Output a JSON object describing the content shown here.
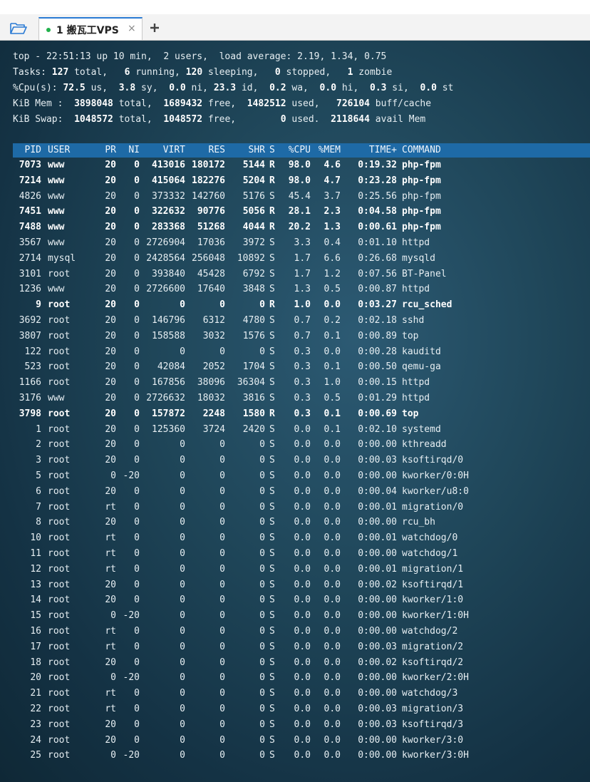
{
  "tabbar": {
    "tab_label": "1 搬瓦工VPS",
    "close_glyph": "×",
    "plus_glyph": "+",
    "status_color": "#22b14c"
  },
  "summary": {
    "line1": [
      [
        "top - 22:51:13 up 10 min,  2 users,  load average: 2.19, 1.34, 0.75",
        false
      ]
    ],
    "line2": [
      [
        "Tasks: ",
        false
      ],
      [
        "127",
        true
      ],
      [
        " total,   ",
        false
      ],
      [
        "6",
        true
      ],
      [
        " running, ",
        false
      ],
      [
        "120",
        true
      ],
      [
        " sleeping,   ",
        false
      ],
      [
        "0",
        true
      ],
      [
        " stopped,   ",
        false
      ],
      [
        "1",
        true
      ],
      [
        " zombie",
        false
      ]
    ],
    "line3": [
      [
        "%Cpu(s): ",
        false
      ],
      [
        "72.5",
        true
      ],
      [
        " us,  ",
        false
      ],
      [
        "3.8",
        true
      ],
      [
        " sy,  ",
        false
      ],
      [
        "0.0",
        true
      ],
      [
        " ni, ",
        false
      ],
      [
        "23.3",
        true
      ],
      [
        " id,  ",
        false
      ],
      [
        "0.2",
        true
      ],
      [
        " wa,  ",
        false
      ],
      [
        "0.0",
        true
      ],
      [
        " hi,  ",
        false
      ],
      [
        "0.3",
        true
      ],
      [
        " si,  ",
        false
      ],
      [
        "0.0",
        true
      ],
      [
        " st",
        false
      ]
    ],
    "line4": [
      [
        "KiB Mem :  ",
        false
      ],
      [
        "3898048",
        true
      ],
      [
        " total,  ",
        false
      ],
      [
        "1689432",
        true
      ],
      [
        " free,  ",
        false
      ],
      [
        "1482512",
        true
      ],
      [
        " used,   ",
        false
      ],
      [
        "726104",
        true
      ],
      [
        " buff/cache",
        false
      ]
    ],
    "line5": [
      [
        "KiB Swap:  ",
        false
      ],
      [
        "1048572",
        true
      ],
      [
        " total,  ",
        false
      ],
      [
        "1048572",
        true
      ],
      [
        " free,        ",
        false
      ],
      [
        "0",
        true
      ],
      [
        " used.  ",
        false
      ],
      [
        "2118644",
        true
      ],
      [
        " avail Mem",
        false
      ]
    ]
  },
  "table": {
    "headers": [
      "PID",
      "USER",
      "PR",
      "NI",
      "VIRT",
      "RES",
      "SHR",
      "S",
      "%CPU",
      "%MEM",
      "TIME+",
      "COMMAND"
    ],
    "rows": [
      {
        "bold": true,
        "cells": [
          "7073",
          "www",
          "20",
          "0",
          "413016",
          "180172",
          "5144",
          "R",
          "98.0",
          "4.6",
          "0:19.32",
          "php-fpm"
        ]
      },
      {
        "bold": true,
        "cells": [
          "7214",
          "www",
          "20",
          "0",
          "415064",
          "182276",
          "5204",
          "R",
          "98.0",
          "4.7",
          "0:23.28",
          "php-fpm"
        ]
      },
      {
        "bold": false,
        "cells": [
          "4826",
          "www",
          "20",
          "0",
          "373332",
          "142760",
          "5176",
          "S",
          "45.4",
          "3.7",
          "0:25.56",
          "php-fpm"
        ]
      },
      {
        "bold": true,
        "cells": [
          "7451",
          "www",
          "20",
          "0",
          "322632",
          "90776",
          "5056",
          "R",
          "28.1",
          "2.3",
          "0:04.58",
          "php-fpm"
        ]
      },
      {
        "bold": true,
        "cells": [
          "7488",
          "www",
          "20",
          "0",
          "283368",
          "51268",
          "4044",
          "R",
          "20.2",
          "1.3",
          "0:00.61",
          "php-fpm"
        ]
      },
      {
        "bold": false,
        "cells": [
          "3567",
          "www",
          "20",
          "0",
          "2726904",
          "17036",
          "3972",
          "S",
          "3.3",
          "0.4",
          "0:01.10",
          "httpd"
        ]
      },
      {
        "bold": false,
        "cells": [
          "2714",
          "mysql",
          "20",
          "0",
          "2428564",
          "256048",
          "10892",
          "S",
          "1.7",
          "6.6",
          "0:26.68",
          "mysqld"
        ]
      },
      {
        "bold": false,
        "cells": [
          "3101",
          "root",
          "20",
          "0",
          "393840",
          "45428",
          "6792",
          "S",
          "1.7",
          "1.2",
          "0:07.56",
          "BT-Panel"
        ]
      },
      {
        "bold": false,
        "cells": [
          "1236",
          "www",
          "20",
          "0",
          "2726600",
          "17640",
          "3848",
          "S",
          "1.3",
          "0.5",
          "0:00.87",
          "httpd"
        ]
      },
      {
        "bold": true,
        "cells": [
          "9",
          "root",
          "20",
          "0",
          "0",
          "0",
          "0",
          "R",
          "1.0",
          "0.0",
          "0:03.27",
          "rcu_sched"
        ]
      },
      {
        "bold": false,
        "cells": [
          "3692",
          "root",
          "20",
          "0",
          "146796",
          "6312",
          "4780",
          "S",
          "0.7",
          "0.2",
          "0:02.18",
          "sshd"
        ]
      },
      {
        "bold": false,
        "cells": [
          "3807",
          "root",
          "20",
          "0",
          "158588",
          "3032",
          "1576",
          "S",
          "0.7",
          "0.1",
          "0:00.89",
          "top"
        ]
      },
      {
        "bold": false,
        "cells": [
          "122",
          "root",
          "20",
          "0",
          "0",
          "0",
          "0",
          "S",
          "0.3",
          "0.0",
          "0:00.28",
          "kauditd"
        ]
      },
      {
        "bold": false,
        "cells": [
          "523",
          "root",
          "20",
          "0",
          "42084",
          "2052",
          "1704",
          "S",
          "0.3",
          "0.1",
          "0:00.50",
          "qemu-ga"
        ]
      },
      {
        "bold": false,
        "cells": [
          "1166",
          "root",
          "20",
          "0",
          "167856",
          "38096",
          "36304",
          "S",
          "0.3",
          "1.0",
          "0:00.15",
          "httpd"
        ]
      },
      {
        "bold": false,
        "cells": [
          "3176",
          "www",
          "20",
          "0",
          "2726632",
          "18032",
          "3816",
          "S",
          "0.3",
          "0.5",
          "0:01.29",
          "httpd"
        ]
      },
      {
        "bold": true,
        "cells": [
          "3798",
          "root",
          "20",
          "0",
          "157872",
          "2248",
          "1580",
          "R",
          "0.3",
          "0.1",
          "0:00.69",
          "top"
        ]
      },
      {
        "bold": false,
        "cells": [
          "1",
          "root",
          "20",
          "0",
          "125360",
          "3724",
          "2420",
          "S",
          "0.0",
          "0.1",
          "0:02.10",
          "systemd"
        ]
      },
      {
        "bold": false,
        "cells": [
          "2",
          "root",
          "20",
          "0",
          "0",
          "0",
          "0",
          "S",
          "0.0",
          "0.0",
          "0:00.00",
          "kthreadd"
        ]
      },
      {
        "bold": false,
        "cells": [
          "3",
          "root",
          "20",
          "0",
          "0",
          "0",
          "0",
          "S",
          "0.0",
          "0.0",
          "0:00.03",
          "ksoftirqd/0"
        ]
      },
      {
        "bold": false,
        "cells": [
          "5",
          "root",
          "0",
          "-20",
          "0",
          "0",
          "0",
          "S",
          "0.0",
          "0.0",
          "0:00.00",
          "kworker/0:0H"
        ]
      },
      {
        "bold": false,
        "cells": [
          "6",
          "root",
          "20",
          "0",
          "0",
          "0",
          "0",
          "S",
          "0.0",
          "0.0",
          "0:00.04",
          "kworker/u8:0"
        ]
      },
      {
        "bold": false,
        "cells": [
          "7",
          "root",
          "rt",
          "0",
          "0",
          "0",
          "0",
          "S",
          "0.0",
          "0.0",
          "0:00.01",
          "migration/0"
        ]
      },
      {
        "bold": false,
        "cells": [
          "8",
          "root",
          "20",
          "0",
          "0",
          "0",
          "0",
          "S",
          "0.0",
          "0.0",
          "0:00.00",
          "rcu_bh"
        ]
      },
      {
        "bold": false,
        "cells": [
          "10",
          "root",
          "rt",
          "0",
          "0",
          "0",
          "0",
          "S",
          "0.0",
          "0.0",
          "0:00.01",
          "watchdog/0"
        ]
      },
      {
        "bold": false,
        "cells": [
          "11",
          "root",
          "rt",
          "0",
          "0",
          "0",
          "0",
          "S",
          "0.0",
          "0.0",
          "0:00.00",
          "watchdog/1"
        ]
      },
      {
        "bold": false,
        "cells": [
          "12",
          "root",
          "rt",
          "0",
          "0",
          "0",
          "0",
          "S",
          "0.0",
          "0.0",
          "0:00.01",
          "migration/1"
        ]
      },
      {
        "bold": false,
        "cells": [
          "13",
          "root",
          "20",
          "0",
          "0",
          "0",
          "0",
          "S",
          "0.0",
          "0.0",
          "0:00.02",
          "ksoftirqd/1"
        ]
      },
      {
        "bold": false,
        "cells": [
          "14",
          "root",
          "20",
          "0",
          "0",
          "0",
          "0",
          "S",
          "0.0",
          "0.0",
          "0:00.00",
          "kworker/1:0"
        ]
      },
      {
        "bold": false,
        "cells": [
          "15",
          "root",
          "0",
          "-20",
          "0",
          "0",
          "0",
          "S",
          "0.0",
          "0.0",
          "0:00.00",
          "kworker/1:0H"
        ]
      },
      {
        "bold": false,
        "cells": [
          "16",
          "root",
          "rt",
          "0",
          "0",
          "0",
          "0",
          "S",
          "0.0",
          "0.0",
          "0:00.00",
          "watchdog/2"
        ]
      },
      {
        "bold": false,
        "cells": [
          "17",
          "root",
          "rt",
          "0",
          "0",
          "0",
          "0",
          "S",
          "0.0",
          "0.0",
          "0:00.03",
          "migration/2"
        ]
      },
      {
        "bold": false,
        "cells": [
          "18",
          "root",
          "20",
          "0",
          "0",
          "0",
          "0",
          "S",
          "0.0",
          "0.0",
          "0:00.02",
          "ksoftirqd/2"
        ]
      },
      {
        "bold": false,
        "cells": [
          "20",
          "root",
          "0",
          "-20",
          "0",
          "0",
          "0",
          "S",
          "0.0",
          "0.0",
          "0:00.00",
          "kworker/2:0H"
        ]
      },
      {
        "bold": false,
        "cells": [
          "21",
          "root",
          "rt",
          "0",
          "0",
          "0",
          "0",
          "S",
          "0.0",
          "0.0",
          "0:00.00",
          "watchdog/3"
        ]
      },
      {
        "bold": false,
        "cells": [
          "22",
          "root",
          "rt",
          "0",
          "0",
          "0",
          "0",
          "S",
          "0.0",
          "0.0",
          "0:00.03",
          "migration/3"
        ]
      },
      {
        "bold": false,
        "cells": [
          "23",
          "root",
          "20",
          "0",
          "0",
          "0",
          "0",
          "S",
          "0.0",
          "0.0",
          "0:00.03",
          "ksoftirqd/3"
        ]
      },
      {
        "bold": false,
        "cells": [
          "24",
          "root",
          "20",
          "0",
          "0",
          "0",
          "0",
          "S",
          "0.0",
          "0.0",
          "0:00.00",
          "kworker/3:0"
        ]
      },
      {
        "bold": false,
        "cells": [
          "25",
          "root",
          "0",
          "-20",
          "0",
          "0",
          "0",
          "S",
          "0.0",
          "0.0",
          "0:00.00",
          "kworker/3:0H"
        ]
      }
    ]
  }
}
